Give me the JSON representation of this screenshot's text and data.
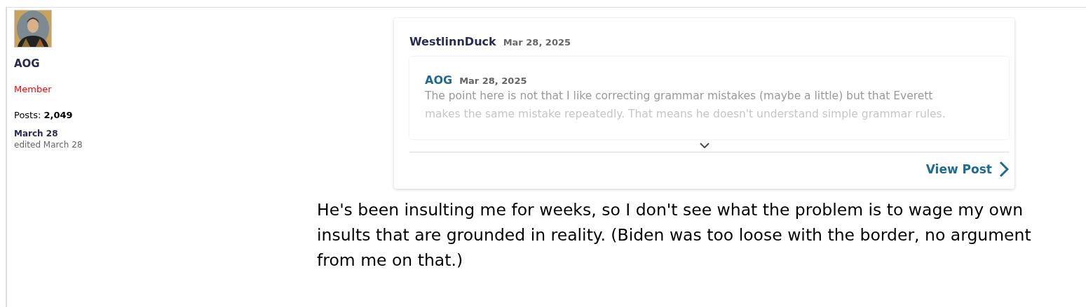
{
  "author": {
    "name": "AOG",
    "role": "Member",
    "posts_label": "Posts:",
    "posts_count": "2,049",
    "date": "March 28",
    "edited": "edited March 28"
  },
  "quote": {
    "author": "WestlinnDuck",
    "date": "Mar 28, 2025",
    "inner": {
      "author": "AOG",
      "date": "Mar 28, 2025",
      "lines": [
        "The point here is not that I like correcting grammar mistakes (maybe a little) but that Everett",
        "makes the same mistake repeatedly. That means he doesn't understand simple grammar rules."
      ]
    },
    "link": "View Post"
  },
  "body": "He's been insulting me for weeks, so I don't see what the problem is to wage my own insults that are grounded in reality. (Biden was too loose with the border, no argument from me on that.)"
}
